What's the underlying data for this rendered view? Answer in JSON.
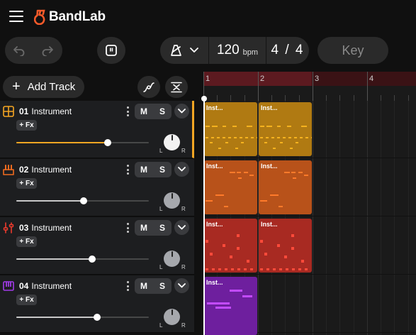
{
  "app": {
    "brand": "BandLab",
    "brand_color": "#f45a2a"
  },
  "transport": {
    "tempo_value": "120",
    "tempo_unit": "bpm",
    "time_signature": "4 / 4",
    "key_label": "Key"
  },
  "toolbar": {
    "add_track_label": "Add Track"
  },
  "tracks": [
    {
      "number": "01",
      "name": "Instrument",
      "mute": "M",
      "solo": "S",
      "fx": "+ Fx",
      "pan_left": "L",
      "pan_right": "R",
      "volume": 0.69,
      "color": "#f5a623",
      "icon": "drum-pads-icon"
    },
    {
      "number": "02",
      "name": "Instrument",
      "mute": "M",
      "solo": "S",
      "fx": "+ Fx",
      "pan_left": "L",
      "pan_right": "R",
      "volume": 0.51,
      "color": "#f06b1f",
      "icon": "keyboard-icon"
    },
    {
      "number": "03",
      "name": "Instrument",
      "mute": "M",
      "solo": "S",
      "fx": "+ Fx",
      "pan_left": "L",
      "pan_right": "R",
      "volume": 0.57,
      "color": "#ef3b2d",
      "icon": "mixer-sliders-icon"
    },
    {
      "number": "04",
      "name": "Instrument",
      "mute": "M",
      "solo": "S",
      "fx": "+ Fx",
      "pan_left": "L",
      "pan_right": "R",
      "volume": 0.61,
      "color": "#a23be8",
      "icon": "synth-keys-icon"
    }
  ],
  "ruler": {
    "bars": [
      "1",
      "2",
      "3",
      "4"
    ]
  },
  "clips": [
    {
      "track": 0,
      "title": "Inst...",
      "color": "#b07a12"
    },
    {
      "track": 0,
      "title": "Inst...",
      "color": "#b07a12"
    },
    {
      "track": 1,
      "title": "Inst...",
      "color": "#b8521a"
    },
    {
      "track": 1,
      "title": "Inst...",
      "color": "#b8521a"
    },
    {
      "track": 2,
      "title": "Inst...",
      "color": "#a82a22"
    },
    {
      "track": 2,
      "title": "Inst...",
      "color": "#a82a22"
    },
    {
      "track": 3,
      "title": "Inst...",
      "color": "#6e1f9e"
    }
  ]
}
